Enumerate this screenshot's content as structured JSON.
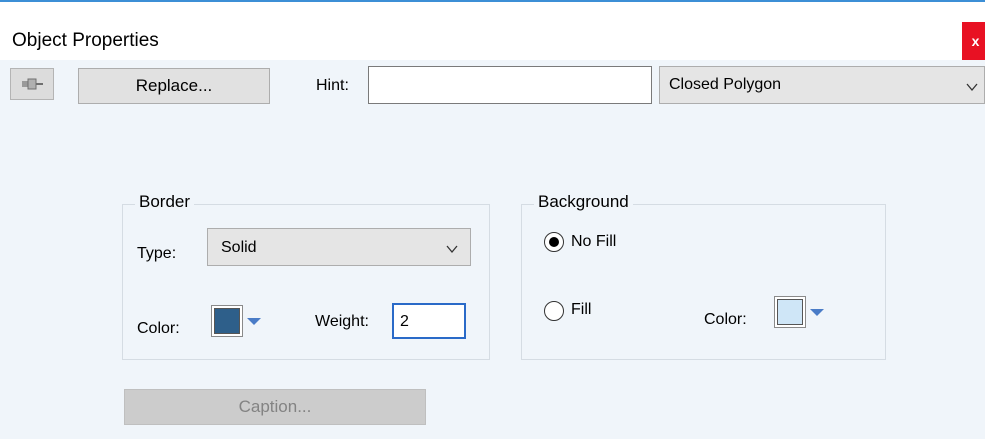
{
  "window": {
    "title": "Object Properties",
    "close_label": "x",
    "accent": "#3c8fd6",
    "close_color": "#e81123"
  },
  "toolbar": {
    "pin_icon": "pushpin-icon",
    "replace_label": "Replace...",
    "hint_label": "Hint:",
    "hint_value": "",
    "shape_value": "Closed Polygon"
  },
  "border": {
    "title": "Border",
    "type_label": "Type:",
    "type_value": "Solid",
    "color_label": "Color:",
    "color": "#2e5f8a",
    "weight_label": "Weight:",
    "weight_value": "2"
  },
  "background": {
    "title": "Background",
    "no_fill_label": "No Fill",
    "fill_label": "Fill",
    "selected": "No Fill",
    "color_label": "Color:",
    "color": "#cfe6f7"
  },
  "caption_label": "Caption..."
}
